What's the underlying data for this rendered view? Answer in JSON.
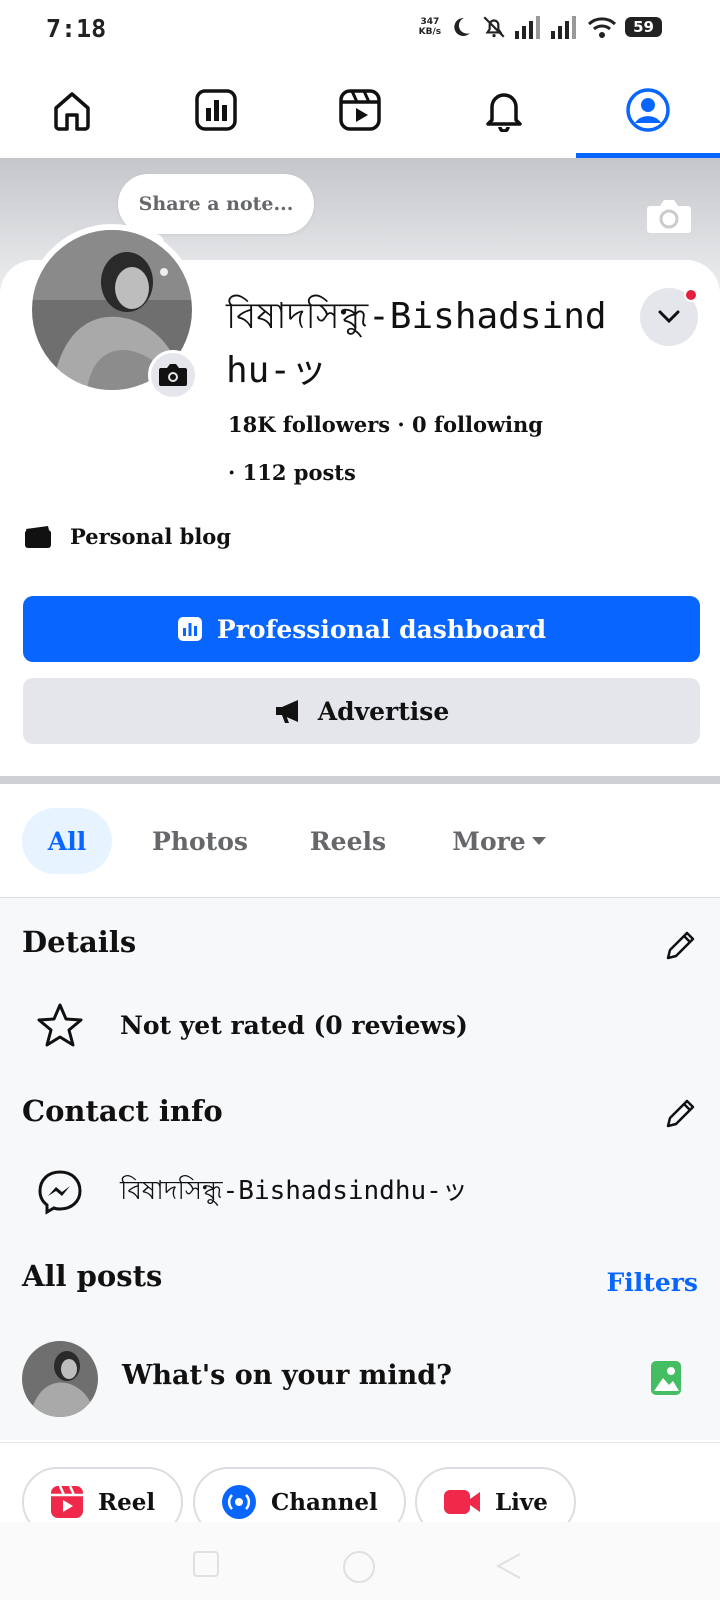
{
  "status_bar": {
    "time": "7:18",
    "net_speed_value": "347",
    "net_speed_unit": "KB/s",
    "battery": "59"
  },
  "nav": {
    "tabs": [
      {
        "icon": "home-icon",
        "active": false
      },
      {
        "icon": "dashboard-icon",
        "active": false
      },
      {
        "icon": "video-icon",
        "active": false
      },
      {
        "icon": "bell-icon",
        "active": false
      },
      {
        "icon": "profile-icon",
        "active": true
      }
    ],
    "accent": "#0866ff"
  },
  "profile": {
    "note_placeholder": "Share a note...",
    "name": "বিষাদসিন্ধু-Bishadsindhu-ッ",
    "stats_line1": "18K followers · 0 following",
    "stats_line2": "· 112 posts",
    "category": "Personal blog"
  },
  "buttons": {
    "primary": "Professional dashboard",
    "secondary": "Advertise"
  },
  "tabs": {
    "items": [
      "All",
      "Photos",
      "Reels",
      "More"
    ],
    "active": "All"
  },
  "details": {
    "title": "Details",
    "rating": "Not yet rated (0 reviews)"
  },
  "contact": {
    "title": "Contact info",
    "messenger": "বিষাদসিন্ধু-Bishadsindhu-ッ"
  },
  "posts": {
    "title": "All posts",
    "filters": "Filters",
    "composer_placeholder": "What's on your mind?"
  },
  "actions": {
    "reel": "Reel",
    "channel": "Channel",
    "live": "Live"
  }
}
